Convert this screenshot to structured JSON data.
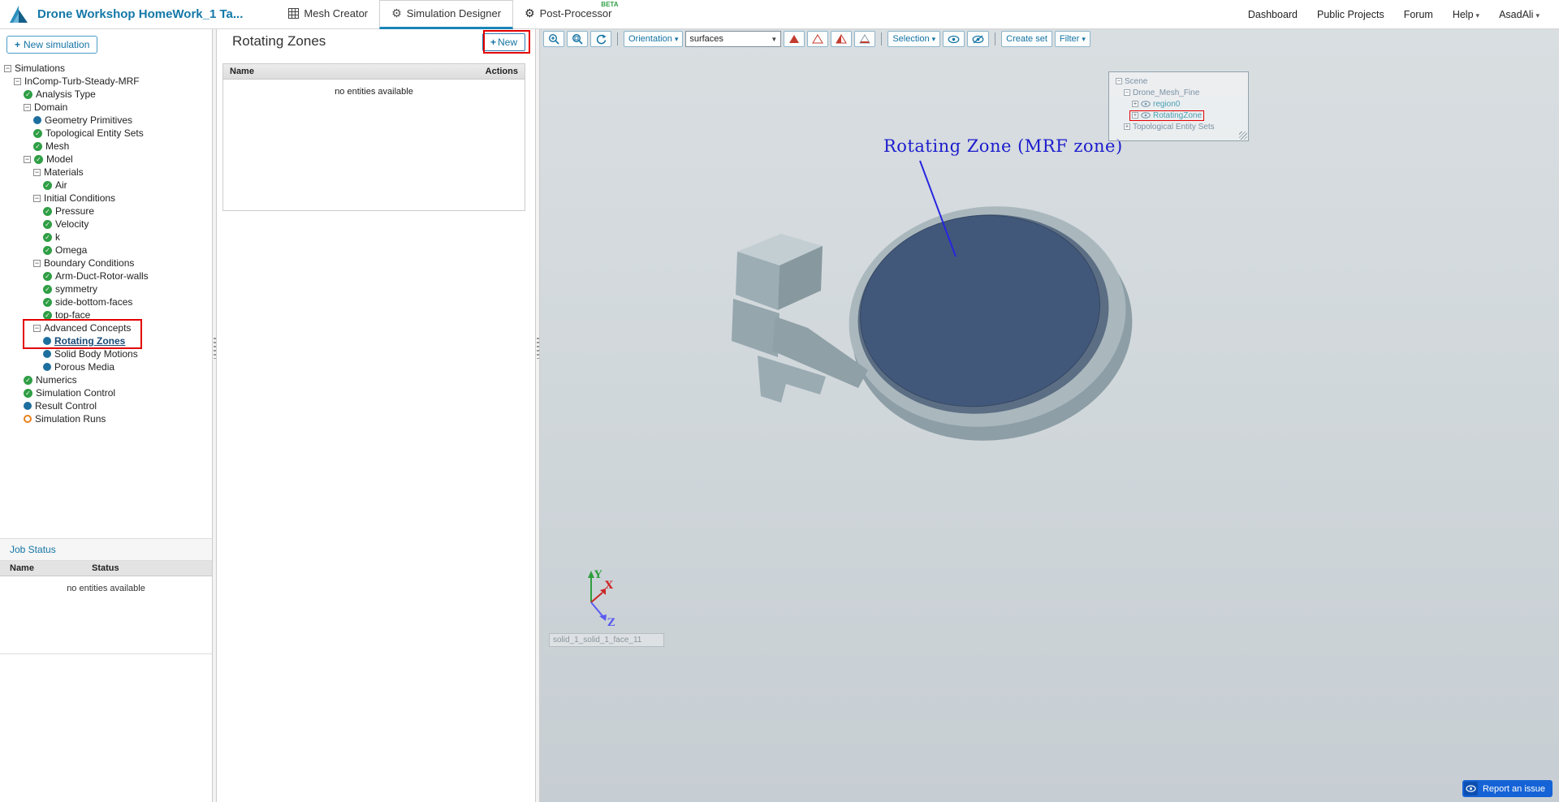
{
  "header": {
    "project_title": "Drone Workshop HomeWork_1 Ta...",
    "tabs": [
      {
        "label": "Mesh Creator",
        "badge": ""
      },
      {
        "label": "Simulation Designer",
        "badge": ""
      },
      {
        "label": "Post-Processor",
        "badge": "BETA"
      }
    ],
    "nav_links": [
      {
        "label": "Dashboard",
        "dropdown": false
      },
      {
        "label": "Public Projects",
        "dropdown": false
      },
      {
        "label": "Forum",
        "dropdown": false
      },
      {
        "label": "Help",
        "dropdown": true
      },
      {
        "label": "AsadAli",
        "dropdown": true
      }
    ]
  },
  "sidebar": {
    "new_simulation_label": "New simulation",
    "tree": [
      {
        "label": "Simulations",
        "indent": 0,
        "expander": "minus",
        "icon": "none",
        "selected": false
      },
      {
        "label": "InComp-Turb-Steady-MRF",
        "indent": 1,
        "expander": "minus",
        "icon": "none",
        "selected": false
      },
      {
        "label": "Analysis Type",
        "indent": 2,
        "expander": "none",
        "icon": "check",
        "selected": false
      },
      {
        "label": "Domain",
        "indent": 2,
        "expander": "minus",
        "icon": "none",
        "selected": false
      },
      {
        "label": "Geometry Primitives",
        "indent": 3,
        "expander": "none",
        "icon": "dot",
        "selected": false
      },
      {
        "label": "Topological Entity Sets",
        "indent": 3,
        "expander": "none",
        "icon": "check",
        "selected": false
      },
      {
        "label": "Mesh",
        "indent": 3,
        "expander": "none",
        "icon": "check",
        "selected": false
      },
      {
        "label": "Model",
        "indent": 2,
        "expander": "minus",
        "icon": "check",
        "selected": false
      },
      {
        "label": "Materials",
        "indent": 3,
        "expander": "minus",
        "icon": "none",
        "selected": false
      },
      {
        "label": "Air",
        "indent": 4,
        "expander": "none",
        "icon": "check",
        "selected": false
      },
      {
        "label": "Initial Conditions",
        "indent": 3,
        "expander": "minus",
        "icon": "none",
        "selected": false
      },
      {
        "label": "Pressure",
        "indent": 4,
        "expander": "none",
        "icon": "check",
        "selected": false
      },
      {
        "label": "Velocity",
        "indent": 4,
        "expander": "none",
        "icon": "check",
        "selected": false
      },
      {
        "label": "k",
        "indent": 4,
        "expander": "none",
        "icon": "check",
        "selected": false
      },
      {
        "label": "Omega",
        "indent": 4,
        "expander": "none",
        "icon": "check",
        "selected": false
      },
      {
        "label": "Boundary Conditions",
        "indent": 3,
        "expander": "minus",
        "icon": "none",
        "selected": false
      },
      {
        "label": "Arm-Duct-Rotor-walls",
        "indent": 4,
        "expander": "none",
        "icon": "check",
        "selected": false
      },
      {
        "label": "symmetry",
        "indent": 4,
        "expander": "none",
        "icon": "check",
        "selected": false
      },
      {
        "label": "side-bottom-faces",
        "indent": 4,
        "expander": "none",
        "icon": "check",
        "selected": false
      },
      {
        "label": "top-face",
        "indent": 4,
        "expander": "none",
        "icon": "check",
        "selected": false
      },
      {
        "label": "Advanced Concepts",
        "indent": 3,
        "expander": "minus",
        "icon": "none",
        "selected": false
      },
      {
        "label": "Rotating Zones",
        "indent": 4,
        "expander": "none",
        "icon": "dot",
        "selected": true
      },
      {
        "label": "Solid Body Motions",
        "indent": 4,
        "expander": "none",
        "icon": "dot",
        "selected": false
      },
      {
        "label": "Porous Media",
        "indent": 4,
        "expander": "none",
        "icon": "dot",
        "selected": false
      },
      {
        "label": "Numerics",
        "indent": 2,
        "expander": "none",
        "icon": "check",
        "selected": false
      },
      {
        "label": "Simulation Control",
        "indent": 2,
        "expander": "none",
        "icon": "check",
        "selected": false
      },
      {
        "label": "Result Control",
        "indent": 2,
        "expander": "none",
        "icon": "dot",
        "selected": false
      },
      {
        "label": "Simulation Runs",
        "indent": 2,
        "expander": "none",
        "icon": "ring",
        "selected": false
      }
    ],
    "job_status": {
      "title": "Job Status",
      "columns": [
        "Name",
        "Status"
      ],
      "empty_text": "no entities available"
    }
  },
  "panel": {
    "title": "Rotating Zones",
    "new_button_label": "New",
    "columns": [
      "Name",
      "Actions"
    ],
    "empty_text": "no entities available"
  },
  "viewport": {
    "toolbar": {
      "orientation_label": "Orientation",
      "render_mode_value": "surfaces",
      "selection_label": "Selection",
      "create_set_label": "Create set",
      "filter_label": "Filter"
    },
    "scene_tree": [
      {
        "label": "Scene",
        "indent": 0,
        "expander": "minus",
        "eye": false,
        "accent": false,
        "highlight": false
      },
      {
        "label": "Drone_Mesh_Fine",
        "indent": 1,
        "expander": "minus",
        "eye": false,
        "accent": false,
        "highlight": false
      },
      {
        "label": "region0",
        "indent": 2,
        "expander": "plus",
        "eye": true,
        "accent": true,
        "highlight": false
      },
      {
        "label": "RotatingZone",
        "indent": 2,
        "expander": "plus",
        "eye": true,
        "accent": true,
        "highlight": true
      },
      {
        "label": "Topological Entity Sets",
        "indent": 1,
        "expander": "plus",
        "eye": false,
        "accent": false,
        "highlight": false
      }
    ],
    "annotation_text": "Rotating Zone (MRF zone)",
    "face_label": "solid_1_solid_1_face_11",
    "axis_labels": {
      "x": "X",
      "y": "Y",
      "z": "Z"
    },
    "report_button_label": "Report an issue"
  },
  "icons": {
    "gear": "⚙",
    "caret_down": "▾",
    "select_arrow": "▼",
    "plus": "+",
    "check": "✓",
    "expander_collapse": "−",
    "expander_expand": "+"
  },
  "colors": {
    "accent_blue": "#1474a4",
    "check_green": "#2f9e44",
    "dot_blue": "#1d6f9e",
    "ring_orange": "#e8821e",
    "highlight_red": "#e20000",
    "disc_blue": "#42587b",
    "report_blue": "#1563d6",
    "annotation_blue": "#1c1ccd"
  }
}
